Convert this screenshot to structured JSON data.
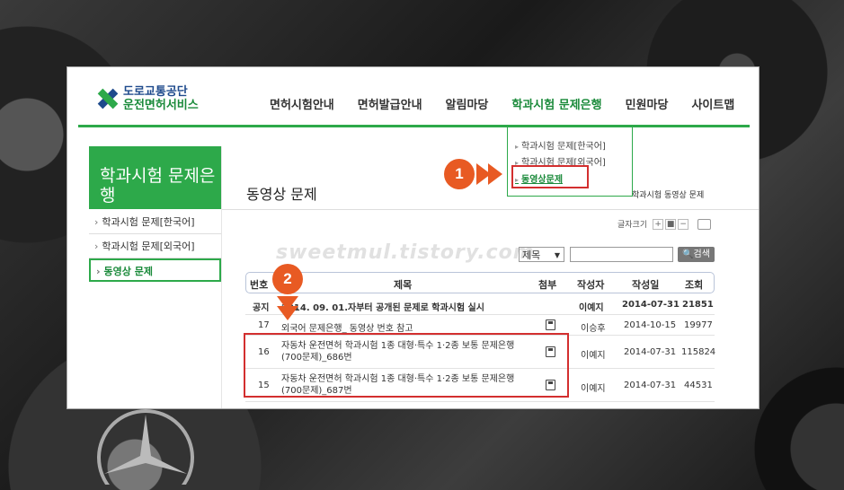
{
  "brand": {
    "line1": "도로교통공단",
    "line2": "운전면허서비스"
  },
  "nav": {
    "items": [
      "면허시험안내",
      "면허발급안내",
      "알림마당",
      "학과시험 문제은행",
      "민원마당",
      "사이트맵"
    ],
    "active_index": 3
  },
  "dropdown": {
    "items": [
      "학과시험 문제[한국어]",
      "학과시험 문제[외국어]",
      "동영상문제"
    ],
    "selected_index": 2
  },
  "sidebar": {
    "title": "학과시험 문제은행",
    "items": [
      "학과시험 문제[한국어]",
      "학과시험 문제[외국어]",
      "동영상 문제"
    ]
  },
  "content": {
    "title": "동영상 문제",
    "breadcrumb": "학과시험 동영상 문제",
    "fontsize_label": "글자크기",
    "fontsize_plus": "+",
    "fontsize_reset": "■",
    "fontsize_minus": "−"
  },
  "watermark": "sweetmul.tistory.com",
  "search": {
    "select_value": "제목",
    "input_value": "",
    "button_label": "검색"
  },
  "table": {
    "headers": [
      "번호",
      "제목",
      "첨부",
      "작성자",
      "작성일",
      "조회"
    ],
    "rows": [
      {
        "num": "공지",
        "title": "2014. 09. 01.자부터 공개된 문제로 학과시험 실시",
        "author": "이예지",
        "date": "2014-07-31",
        "views": "21851",
        "attach": false
      },
      {
        "num": "17",
        "title": "외국어 문제은행_ 동영상 번호 참고",
        "author": "이승후",
        "date": "2014-10-15",
        "views": "19977",
        "attach": true
      },
      {
        "num": "16",
        "title": "자동차 운전면허 학과시험 1종 대형·특수 1·2종 보통 문제은행(700문제)_686번",
        "author": "이예지",
        "date": "2014-07-31",
        "views": "115824",
        "attach": true
      },
      {
        "num": "15",
        "title": "자동차 운전면허 학과시험 1종 대형·특수 1·2종 보통 문제은행(700문제)_687번",
        "author": "이예지",
        "date": "2014-07-31",
        "views": "44531",
        "attach": true
      }
    ]
  },
  "annotations": {
    "step1": "1",
    "step2": "2"
  },
  "colors": {
    "accent_green": "#2da94a",
    "annotation_orange": "#e85a23",
    "highlight_red": "#d32f2f"
  }
}
